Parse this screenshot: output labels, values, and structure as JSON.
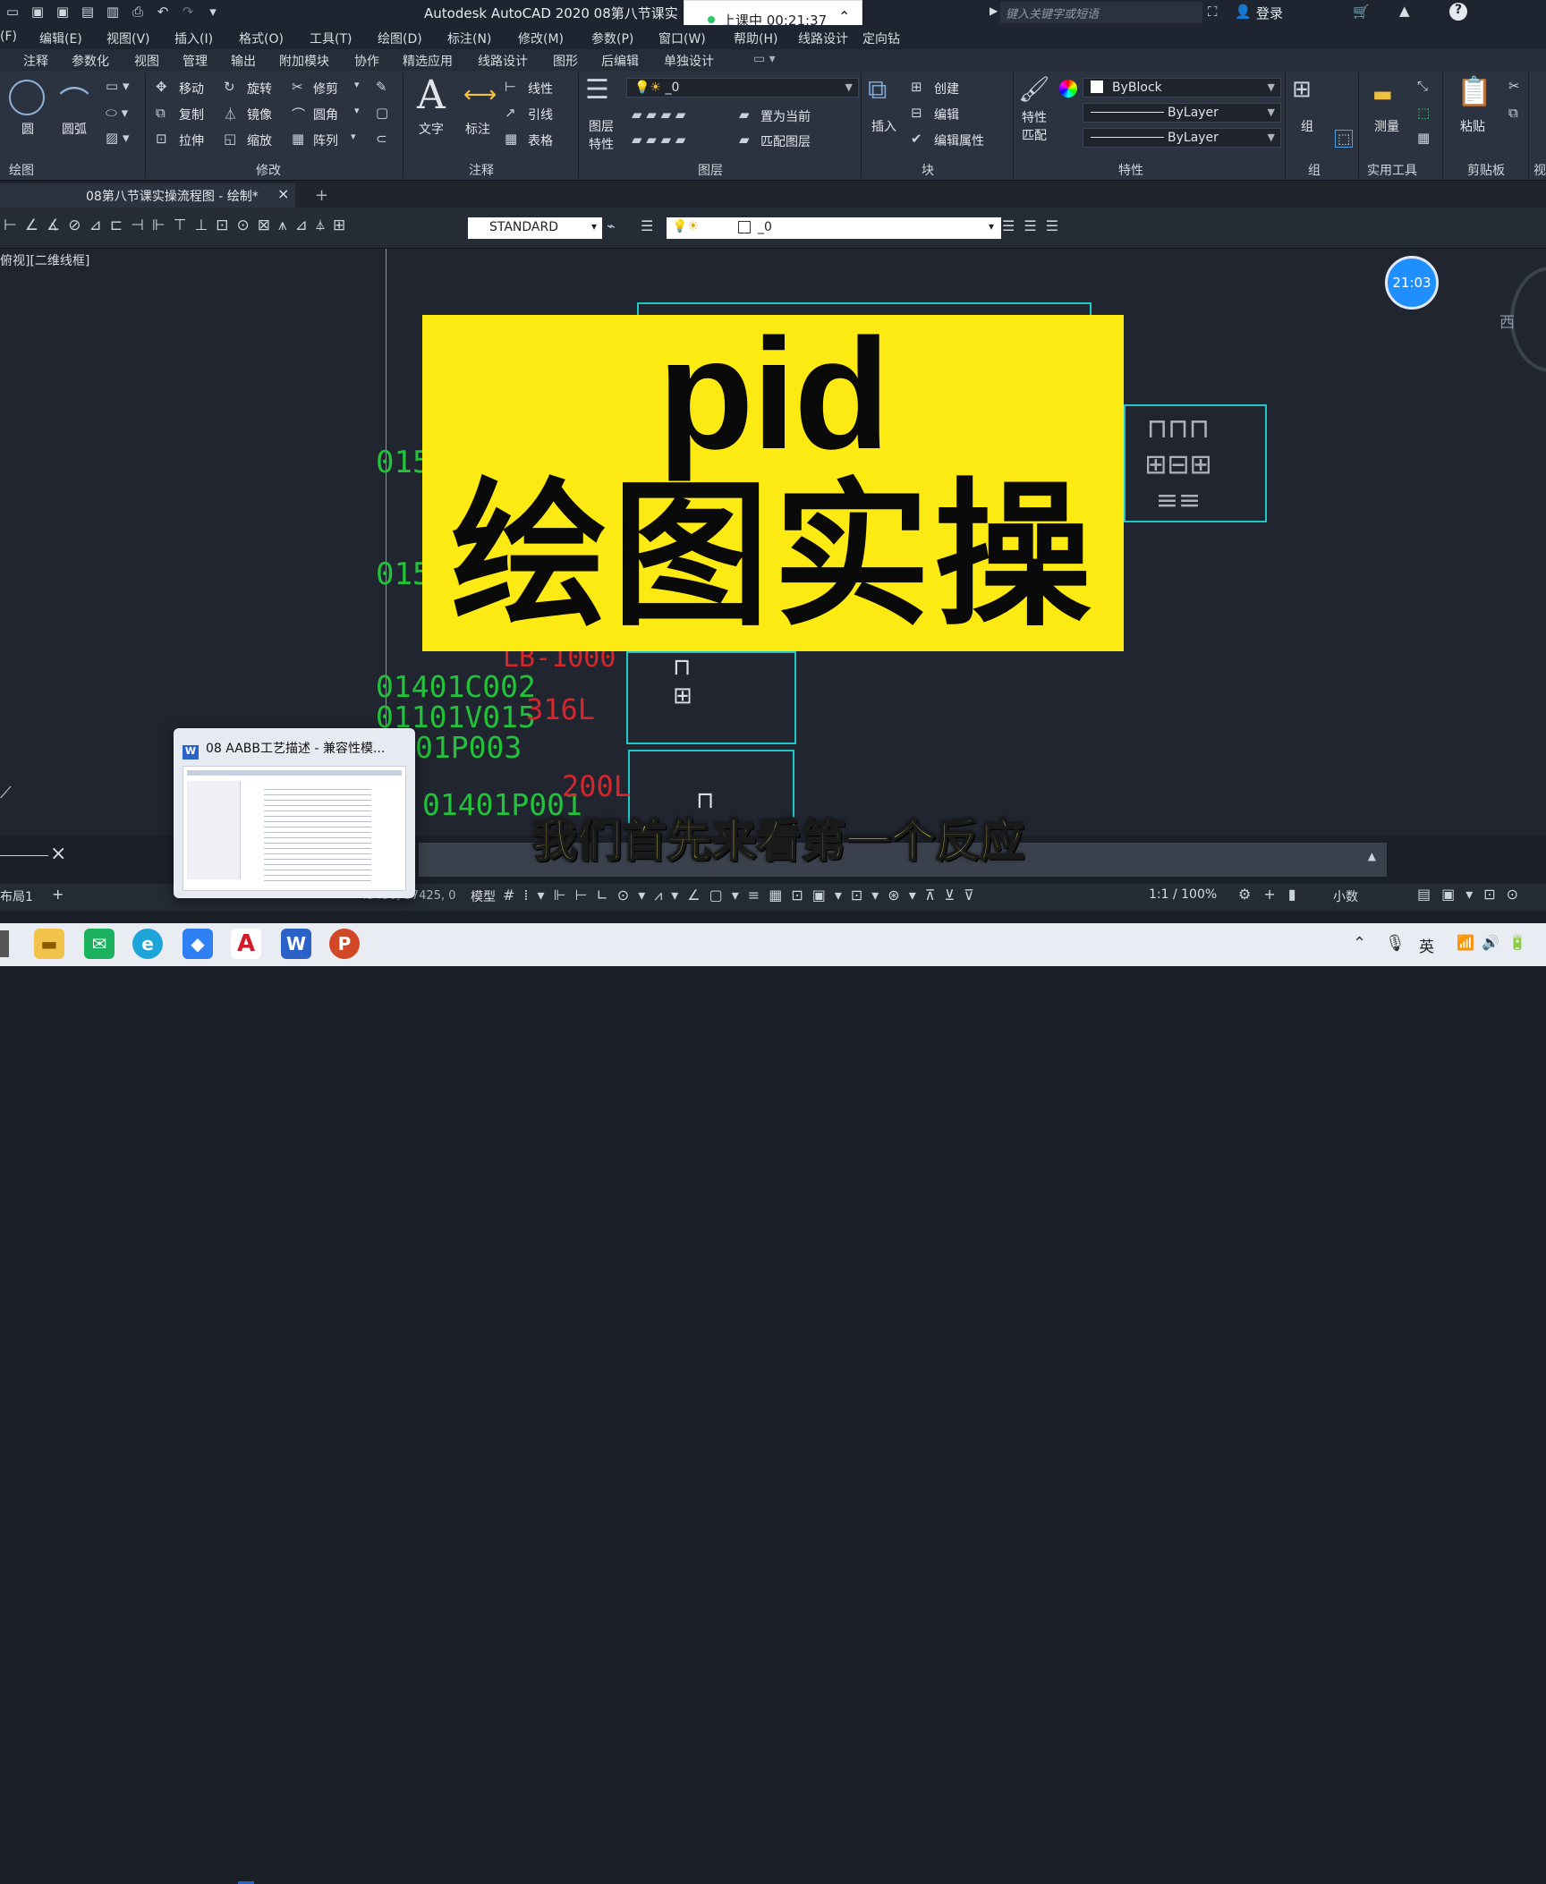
{
  "titlebar": {
    "app_title": "Autodesk AutoCAD 2020    08第八节课实",
    "class_status": "上课中 00:21:37",
    "search_placeholder": "键入关键字或短语",
    "login": "登录"
  },
  "menu": [
    "(F)",
    "编辑(E)",
    "视图(V)",
    "插入(I)",
    "格式(O)",
    "工具(T)",
    "绘图(D)",
    "标注(N)",
    "修改(M)",
    "参数(P)",
    "窗口(W)",
    "帮助(H)",
    "线路设计",
    "定向钻"
  ],
  "ribbon_tabs": [
    "注释",
    "参数化",
    "视图",
    "管理",
    "输出",
    "附加模块",
    "协作",
    "精选应用",
    "线路设计",
    "图形",
    "后编辑",
    "单独设计"
  ],
  "ribbon": {
    "draw": {
      "circle": "圆",
      "arc": "圆弧",
      "panel": "绘图"
    },
    "modify": {
      "move": "移动",
      "rotate": "旋转",
      "trim": "修剪",
      "copy": "复制",
      "mirror": "镜像",
      "fillet": "圆角",
      "stretch": "拉伸",
      "scale": "缩放",
      "array": "阵列",
      "panel": "修改"
    },
    "annotation": {
      "text": "文字",
      "dim": "标注",
      "linear": "线性",
      "leader": "引线",
      "table": "表格",
      "panel": "注释"
    },
    "layers": {
      "props_line1": "图层",
      "props_line2": "特性",
      "current_layer": "_0",
      "set_current": "置为当前",
      "match_layer": "匹配图层",
      "panel": "图层"
    },
    "block": {
      "insert": "插入",
      "create": "创建",
      "edit": "编辑",
      "edit_attr": "编辑属性",
      "panel": "块"
    },
    "properties": {
      "match_line1": "特性",
      "match_line2": "匹配",
      "color": "ByBlock",
      "linetype": "ByLayer",
      "lineweight": "ByLayer",
      "panel": "特性"
    },
    "group": {
      "label": "组",
      "panel": "组"
    },
    "utilities": {
      "measure": "测量",
      "panel": "实用工具"
    },
    "clipboard": {
      "paste": "粘贴",
      "panel": "剪贴板"
    },
    "view_panel": "视"
  },
  "file_tab": "08第八节课实操流程图 - 绘制*",
  "toolbar": {
    "text_style": "STANDARD",
    "layer": "_0"
  },
  "canvas": {
    "view_label": "俯视][二维线框]",
    "compass_w": "西",
    "labels_green": [
      "015",
      "015",
      "01401C002",
      "01101V015",
      "01P003",
      "01401P001"
    ],
    "labels_red": [
      "LB-1000",
      "316L",
      "200L"
    ]
  },
  "overlay": {
    "line1": "pid",
    "line2": "绘图实操",
    "subtitle": "我们首先来看第一个反应",
    "timer": "21:03"
  },
  "word_preview": {
    "title": "08 AABB工艺描述 - 兼容性模..."
  },
  "statusbar": {
    "coords": "45430, 37425, 0",
    "model": "模型",
    "scale": "1:1 / 100%",
    "units": "小数",
    "layout": "布局1"
  },
  "taskbar": {
    "ime": "英"
  },
  "colors": {
    "accent_yellow": "#fcea12",
    "cad_green": "#22c23a",
    "cad_red": "#d7262b",
    "frame_cyan": "#22c8c8"
  }
}
